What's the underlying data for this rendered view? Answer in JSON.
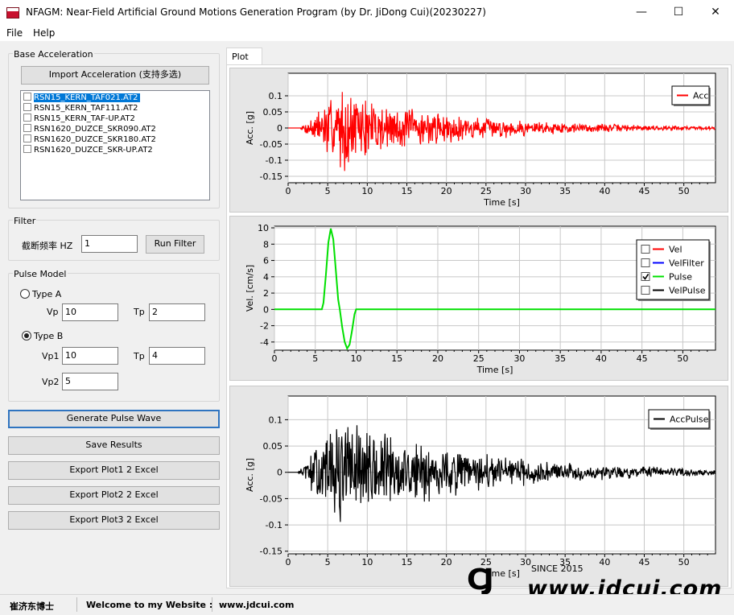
{
  "window": {
    "title": "NFAGM: Near-Field Artificial Ground Motions Generation Program (by Dr. JiDong Cui)(20230227)",
    "icon_text": "NFAGM"
  },
  "menu": [
    "File",
    "Help"
  ],
  "base_acceleration": {
    "title": "Base Acceleration",
    "import_button": "Import Acceleration (支持多选)",
    "files": [
      "RSN15_KERN_TAF021.AT2",
      "RSN15_KERN_TAF111.AT2",
      "RSN15_KERN_TAF-UP.AT2",
      "RSN1620_DUZCE_SKR090.AT2",
      "RSN1620_DUZCE_SKR180.AT2",
      "RSN1620_DUZCE_SKR-UP.AT2"
    ],
    "selected_index": 0
  },
  "filter": {
    "title": "Filter",
    "label": "截断频率 HZ",
    "value": "1",
    "run_button": "Run Filter"
  },
  "pulse_model": {
    "title": "Pulse Model",
    "type_a": {
      "label": "Type A",
      "checked": false,
      "vp_label": "Vp",
      "vp": "10",
      "tp_label": "Tp",
      "tp": "2"
    },
    "type_b": {
      "label": "Type B",
      "checked": true,
      "vp1_label": "Vp1",
      "vp1": "10",
      "tp_label": "Tp",
      "tp": "4",
      "vp2_label": "Vp2",
      "vp2": "5"
    }
  },
  "actions": {
    "generate": "Generate Pulse Wave",
    "save": "Save Results",
    "export1": "Export Plot1 2 Excel",
    "export2": "Export Plot2 2 Excel",
    "export3": "Export Plot3 2 Excel"
  },
  "tabs": [
    "Plot"
  ],
  "status": {
    "author": "崔济东博士",
    "welcome": "Welcome to my Website :",
    "url": "www.jdcui.com"
  },
  "watermark": {
    "logo": "CJ",
    "since": "SINCE 2015",
    "url": "www.jdcui.com"
  },
  "chart_data": [
    {
      "type": "line",
      "title": "",
      "xlabel": "Time [s]",
      "ylabel": "Acc. [g]",
      "xlim": [
        0,
        54
      ],
      "ylim": [
        -0.17,
        0.17
      ],
      "xticks": [
        0,
        5,
        10,
        15,
        20,
        25,
        30,
        35,
        40,
        45,
        50
      ],
      "yticks": [
        -0.15,
        -0.1,
        -0.05,
        0,
        0.05,
        0.1
      ],
      "grid": true,
      "legend_position": "top-right",
      "series": [
        {
          "name": "Acc",
          "color": "#ff0000",
          "signal": {
            "start": 1.5,
            "end": 54,
            "peak": 0.145,
            "peak_time": 6.5,
            "decay": 0.06,
            "seed": 7
          }
        }
      ]
    },
    {
      "type": "line",
      "title": "",
      "xlabel": "Time [s]",
      "ylabel": "Vel. [cm/s]",
      "xlim": [
        0,
        54
      ],
      "ylim": [
        -5,
        10.2
      ],
      "xticks": [
        0,
        5,
        10,
        15,
        20,
        25,
        30,
        35,
        40,
        45,
        50
      ],
      "yticks": [
        -4,
        -2,
        0,
        2,
        4,
        6,
        8,
        10
      ],
      "grid": true,
      "legend_position": "top-right",
      "series": [
        {
          "name": "Vel",
          "color": "#ff0000",
          "checked": false
        },
        {
          "name": "VelFilter",
          "color": "#0000ff",
          "checked": false
        },
        {
          "name": "Pulse",
          "color": "#00e000",
          "checked": true,
          "points": [
            [
              0,
              0
            ],
            [
              5.8,
              0
            ],
            [
              6.0,
              0.8
            ],
            [
              6.3,
              4.2
            ],
            [
              6.6,
              8.2
            ],
            [
              6.9,
              9.9
            ],
            [
              7.2,
              8.6
            ],
            [
              7.5,
              5.0
            ],
            [
              7.8,
              1.2
            ],
            [
              8.0,
              0
            ],
            [
              8.3,
              -2.2
            ],
            [
              8.6,
              -4.0
            ],
            [
              8.9,
              -4.8
            ],
            [
              9.2,
              -4.3
            ],
            [
              9.5,
              -2.6
            ],
            [
              9.8,
              -0.6
            ],
            [
              10.0,
              0
            ],
            [
              54,
              0
            ]
          ]
        },
        {
          "name": "VelPulse",
          "color": "#000000",
          "checked": false
        }
      ]
    },
    {
      "type": "line",
      "title": "",
      "xlabel": "Time [s]",
      "ylabel": "Acc. [g]",
      "xlim": [
        0,
        54
      ],
      "ylim": [
        -0.155,
        0.145
      ],
      "xticks": [
        0,
        5,
        10,
        15,
        20,
        25,
        30,
        35,
        40,
        45,
        50
      ],
      "yticks": [
        -0.15,
        -0.1,
        -0.05,
        0,
        0.05,
        0.1
      ],
      "grid": true,
      "legend_position": "top-right",
      "series": [
        {
          "name": "AccPulse",
          "color": "#000000",
          "signal": {
            "start": 1.2,
            "end": 54,
            "peak": 0.13,
            "peak_time": 7.0,
            "decay": 0.055,
            "seed": 13
          }
        }
      ]
    }
  ]
}
